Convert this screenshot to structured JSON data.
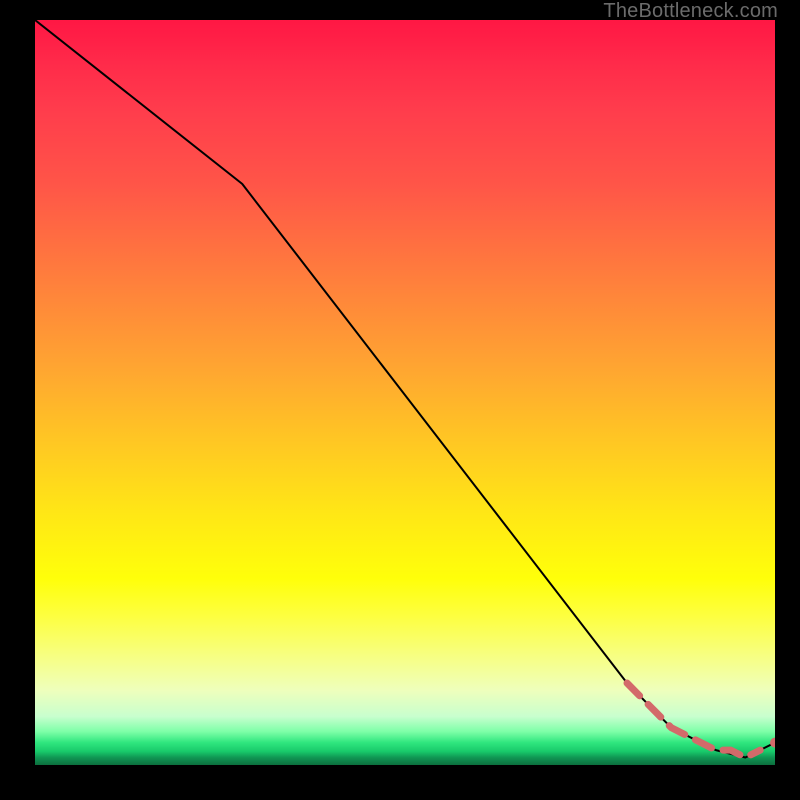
{
  "watermark": "TheBottleneck.com",
  "colors": {
    "background": "#000000",
    "line_primary": "#000000",
    "series_dashed": "#d36a6a",
    "series_point": "#d36a6a"
  },
  "chart_data": {
    "type": "line",
    "title": "",
    "xlabel": "",
    "ylabel": "",
    "xlim": [
      0,
      100
    ],
    "ylim": [
      0,
      100
    ],
    "grid": false,
    "legend": false,
    "series": [
      {
        "name": "bottleneck-curve",
        "style": "solid",
        "color": "#000000",
        "x": [
          0,
          28,
          80,
          86,
          92,
          96,
          100
        ],
        "y": [
          100,
          78,
          11,
          5,
          2,
          1,
          3
        ]
      },
      {
        "name": "optimal-region-dashed",
        "style": "dashed",
        "color": "#d36a6a",
        "x": [
          80,
          82,
          84,
          86,
          88,
          90,
          92,
          94,
          96,
          98
        ],
        "y": [
          11,
          9,
          7,
          5,
          4,
          3,
          2,
          2,
          1,
          2
        ]
      },
      {
        "name": "endpoint-marker",
        "style": "point",
        "color": "#d36a6a",
        "x": [
          100
        ],
        "y": [
          3
        ]
      }
    ]
  }
}
